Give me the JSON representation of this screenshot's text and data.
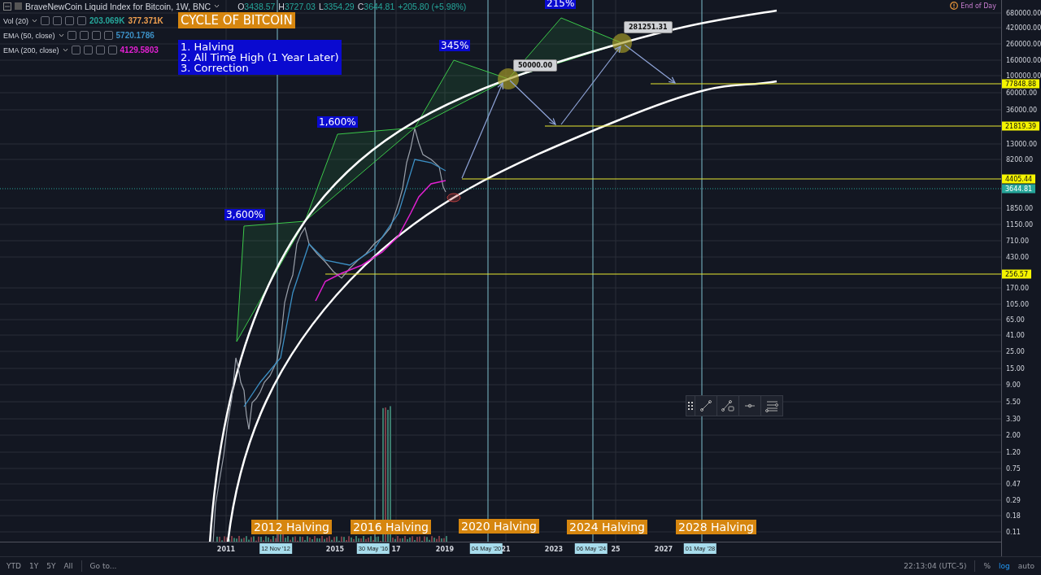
{
  "header": {
    "symbol": "BraveNewCoin Liquid Index for Bitcoin, 1W, BNC",
    "ohlc": [
      {
        "key": "O",
        "value": "3438.57"
      },
      {
        "key": "H",
        "value": "3727.03"
      },
      {
        "key": "L",
        "value": "3354.29"
      },
      {
        "key": "C",
        "value": "3644.81"
      }
    ],
    "change": "+205.80 (+5.98%)"
  },
  "indicators": [
    {
      "name": "Vol (20)",
      "values": [
        {
          "text": "203.069K",
          "color": "#26a69a"
        },
        {
          "text": "377.371K",
          "color": "#f0a050"
        }
      ]
    },
    {
      "name": "EMA (50, close)",
      "values": [
        {
          "text": "5720.1786",
          "color": "#3c8fc4"
        }
      ]
    },
    {
      "name": "EMA (200, close)",
      "values": [
        {
          "text": "4129.5803",
          "color": "#e020d0"
        }
      ]
    }
  ],
  "end_of_day": "End of Day",
  "annotations": {
    "title": "CYCLE OF BITCOIN",
    "steps": [
      "1. Halving",
      "2. All Time High (1 Year Later)",
      "3. Correction"
    ],
    "percents": [
      "3,600%",
      "1,600%",
      "345%",
      "215%"
    ],
    "halvings": [
      "2012 Halving",
      "2016 Halving",
      "2020 Halving",
      "2024 Halving",
      "2028 Halving"
    ],
    "price_tags": [
      "50000.00",
      "281251.31"
    ]
  },
  "price_axis": {
    "labels": [
      "680000.00",
      "420000.00",
      "260000.00",
      "160000.00",
      "100000.00",
      "60000.00",
      "36000.00",
      "13000.00",
      "8200.00",
      "1850.00",
      "1150.00",
      "710.00",
      "430.00",
      "170.00",
      "105.00",
      "65.00",
      "41.00",
      "25.00",
      "15.00",
      "9.00",
      "5.50",
      "3.30",
      "2.00",
      "1.20",
      "0.75",
      "0.47",
      "0.29",
      "0.18",
      "0.11"
    ],
    "tags": [
      {
        "text": "77848.88",
        "kind": "level"
      },
      {
        "text": "21819.39",
        "kind": "level"
      },
      {
        "text": "4405.44",
        "kind": "level"
      },
      {
        "text": "3644.81",
        "kind": "last"
      },
      {
        "text": "256.57",
        "kind": "level"
      }
    ]
  },
  "time_axis": {
    "labels": [
      "2011",
      "2015",
      "17",
      "2019",
      "21",
      "2023",
      "25",
      "2027"
    ],
    "halving_dates": [
      "12 Nov '12",
      "30 May '16",
      "04 May '20",
      "06 May '24",
      "01 May '28"
    ]
  },
  "bottom_bar": {
    "ranges": [
      "YTD",
      "1Y",
      "5Y",
      "All"
    ],
    "goto": "Go to...",
    "clock": "22:13:04 (UTC-5)",
    "scale_options": [
      {
        "label": "%",
        "selected": false
      },
      {
        "label": "log",
        "selected": true
      },
      {
        "label": "auto",
        "selected": false
      }
    ]
  }
}
